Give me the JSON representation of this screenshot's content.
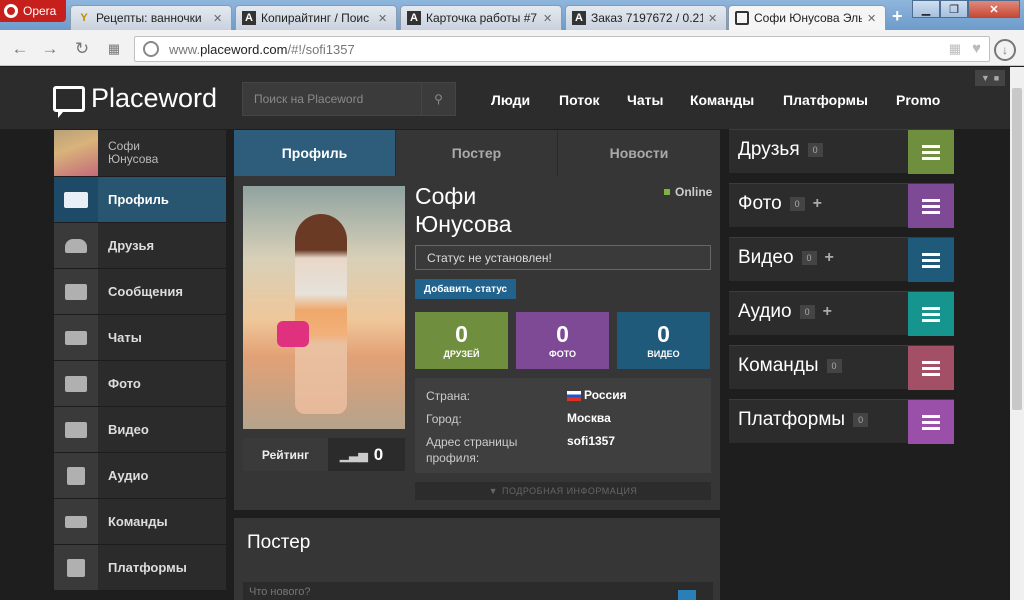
{
  "browser": {
    "opera_label": "Opera",
    "tabs": [
      {
        "title": "Рецепты: ванночки"
      },
      {
        "title": "Копирайтинг / Поис"
      },
      {
        "title": "Карточка работы #7"
      },
      {
        "title": "Заказ 7197672 / 0.21"
      },
      {
        "title": "Софи Юнусова Эль"
      }
    ],
    "url_prefix": "www.",
    "url_host": "placeword.com",
    "url_path": "/#!/sofi1357"
  },
  "site": {
    "logo": "Placeword",
    "search_placeholder": "Поиск на Placeword",
    "nav": [
      "Люди",
      "Поток",
      "Чаты",
      "Команды",
      "Платформы",
      "Promo"
    ]
  },
  "sidebar": {
    "user_name": "Софи Юнусова",
    "items": [
      {
        "label": "Профиль",
        "icon": "profile-card-icon"
      },
      {
        "label": "Друзья",
        "icon": "friends-icon"
      },
      {
        "label": "Сообщения",
        "icon": "message-icon"
      },
      {
        "label": "Чаты",
        "icon": "chats-icon"
      },
      {
        "label": "Фото",
        "icon": "photo-icon"
      },
      {
        "label": "Видео",
        "icon": "video-icon"
      },
      {
        "label": "Аудио",
        "icon": "audio-icon"
      },
      {
        "label": "Команды",
        "icon": "teams-icon"
      },
      {
        "label": "Платформы",
        "icon": "platforms-icon"
      }
    ]
  },
  "profile": {
    "tabs": [
      "Профиль",
      "Постер",
      "Новости"
    ],
    "name_first": "Софи",
    "name_last": "Юнусова",
    "online": "Online",
    "status_text": "Статус не установлен!",
    "add_status": "Добавить статус",
    "stats": [
      {
        "value": "0",
        "label": "ДРУЗЕЙ",
        "color": "#6f8f3e"
      },
      {
        "value": "0",
        "label": "ФОТО",
        "color": "#7e4a96"
      },
      {
        "value": "0",
        "label": "ВИДЕО",
        "color": "#1f5a7a"
      }
    ],
    "info": {
      "country_label": "Страна:",
      "country": "Россия",
      "city_label": "Город:",
      "city": "Москва",
      "address_label": "Адрес страницы профиля:",
      "address": "sofi1357"
    },
    "rating_label": "Рейтинг",
    "rating_value": "0",
    "more_info": "ПОДРОБНАЯ ИНФОРМАЦИЯ",
    "poster_title": "Постер",
    "poster_placeholder": "Что нового?"
  },
  "widgets": [
    {
      "title": "Друзья",
      "count": "0",
      "plus": false,
      "color": "#6f8f3e"
    },
    {
      "title": "Фото",
      "count": "0",
      "plus": true,
      "color": "#7e4a96"
    },
    {
      "title": "Видео",
      "count": "0",
      "plus": true,
      "color": "#1f5a7a"
    },
    {
      "title": "Аудио",
      "count": "0",
      "plus": true,
      "color": "#15958d"
    },
    {
      "title": "Команды",
      "count": "0",
      "plus": false,
      "color": "#a34f66"
    },
    {
      "title": "Платформы",
      "count": "0",
      "plus": false,
      "color": "#9a4fa8"
    }
  ]
}
